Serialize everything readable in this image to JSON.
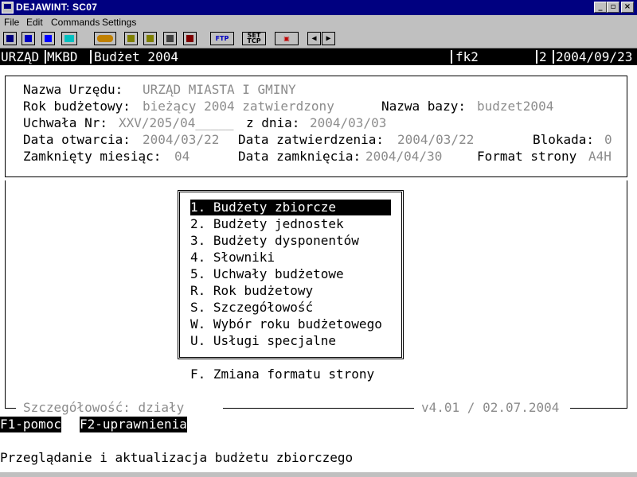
{
  "window": {
    "title": "DEJAWINT: SC07",
    "buttons": [
      "_",
      "▫",
      "×"
    ]
  },
  "menubar": [
    "File",
    "Edit",
    "Commands",
    "Settings"
  ],
  "toolbar": {
    "ftp_label": "FTP",
    "set_label": "SET",
    "tcp_label": "TCP"
  },
  "status": {
    "office": "URZĄD",
    "db": "MKBD",
    "module": "Budżet 2004",
    "user": "fk2",
    "num": "2",
    "date": "2004/09/23"
  },
  "info": {
    "office_label": "Nazwa Urzędu:",
    "office_value": "URZĄD MIASTA I GMINY",
    "year_label": "Rok budżetowy:",
    "year_value": "bieżący 2004 zatwierdzony",
    "dbname_label": "Nazwa bazy:",
    "dbname_value": "budzet2004",
    "resolution_label": "Uchwała Nr:",
    "resolution_value": "XXV/205/04_____",
    "resolution_date_label": "z dnia:",
    "resolution_date_value": "2004/03/03",
    "open_label": "Data otwarcia:",
    "open_value": "2004/03/22",
    "approve_label": "Data zatwierdzenia:",
    "approve_value": "2004/03/22",
    "lock_label": "Blokada:",
    "lock_value": "0",
    "closed_month_label": "Zamknięty miesiąc:",
    "closed_month_value": "04",
    "close_date_label": "Data zamknięcia:",
    "close_date_value": "2004/04/30",
    "format_label": "Format strony",
    "format_value": "A4H"
  },
  "menu": {
    "items": [
      {
        "key": "1",
        "label": ". Budżety zbiorcze",
        "selected": true
      },
      {
        "key": "2",
        "label": ". Budżety jednostek"
      },
      {
        "key": "3",
        "label": ". Budżety dysponentów"
      },
      {
        "key": "4",
        "label": ". Słowniki"
      },
      {
        "key": "5",
        "label": ". Uchwały budżetowe"
      },
      {
        "key": "R",
        "label": ". Rok budżetowy"
      },
      {
        "key": "S",
        "label": ". Szczegółowość"
      },
      {
        "key": "W",
        "label": ". Wybór roku budżetowego"
      },
      {
        "key": "U",
        "label": ". Usługi specjalne"
      }
    ],
    "extra": "F. Zmiana formatu strony"
  },
  "footer": {
    "detail": "Szczegółowość: działy",
    "version": "v4.01 / 02.07.2004"
  },
  "keys": {
    "f1": "F1-pomoc",
    "f2": "F2-uprawnienia"
  },
  "hint": "Przeglądanie i aktualizacja budżetu zbiorczego",
  "colors": {
    "titlebar": "#000080",
    "chrome": "#c0c0c0",
    "dim_text": "#8c8c8c"
  }
}
